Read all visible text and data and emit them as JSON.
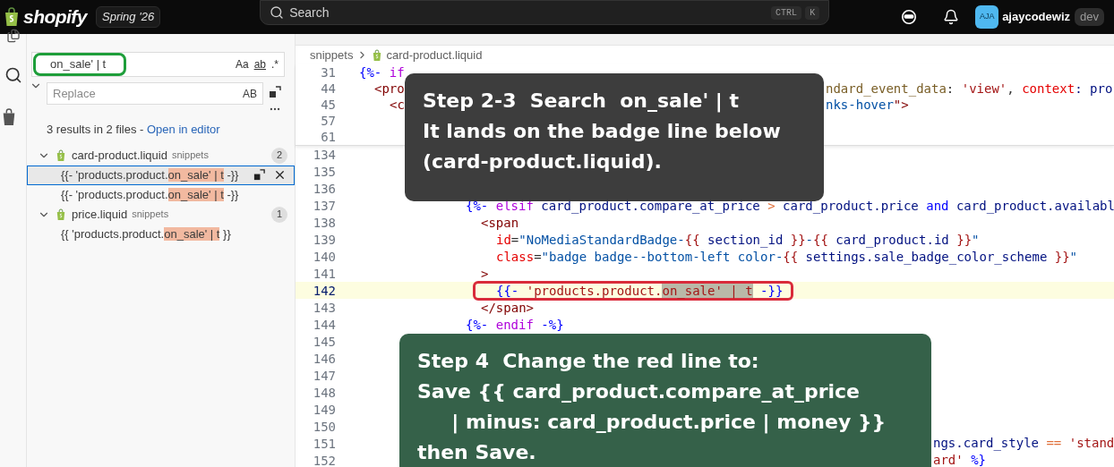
{
  "topbar": {
    "brand": "shopify",
    "release": "Spring '26",
    "search": {
      "placeholder": "Search",
      "keys": [
        "CTRL",
        "K"
      ]
    },
    "avatar": "AJA",
    "user": "ajaycodewiz",
    "env": "dev"
  },
  "sidebar": {
    "search": {
      "value": "on_sale' | t",
      "annotated": true,
      "options": [
        "Aa",
        "ab",
        ".*"
      ]
    },
    "replace": {
      "placeholder": "Replace",
      "option": "AB"
    },
    "summary": "3 results in 2 files - ",
    "summary_link": "Open in editor",
    "files": [
      {
        "name": "card-product.liquid",
        "folder": "snippets",
        "count": "2",
        "expanded": true,
        "results": [
          {
            "before": "{{- 'products.product.",
            "match": "on_sale' | t",
            "after": " -}}",
            "selected": true
          },
          {
            "before": "{{- 'products.product.",
            "match": "on_sale' | t",
            "after": " -}}",
            "selected": false
          }
        ]
      },
      {
        "name": "price.liquid",
        "folder": "snippets",
        "count": "1",
        "expanded": true,
        "results": [
          {
            "before": "{{ 'products.product.",
            "match": "on_sale' | t",
            "after": " }}",
            "selected": false
          }
        ]
      }
    ]
  },
  "editor": {
    "breadcrumb": [
      "snippets",
      "card-product.liquid"
    ],
    "sticky_lines": [
      {
        "number": "31",
        "current": false,
        "code": [
          {
            "text": "{%-",
            "kind": "delim"
          },
          {
            "text": " if",
            "kind": "keyword"
          }
        ]
      },
      {
        "number": "44",
        "current": false,
        "code": [
          {
            "text": "<pro",
            "kind": "tag"
          }
        ],
        "tail": [
          {
            "text": "ndard_event_data",
            "kind": "func"
          },
          {
            "text": ": ",
            "kind": "plain"
          },
          {
            "text": "'view'",
            "kind": "str2"
          },
          {
            "text": ", ",
            "kind": "plain"
          },
          {
            "text": "context",
            "kind": "attr"
          },
          {
            "text": ": pro",
            "kind": "var"
          }
        ]
      },
      {
        "number": "45",
        "current": false,
        "code": [
          {
            "text": "<c",
            "kind": "tag"
          }
        ],
        "tail": [
          {
            "text": "nks-hover",
            "kind": "string"
          },
          {
            "text": "\">",
            "kind": "tag"
          }
        ]
      },
      {
        "number": "57",
        "current": false
      },
      {
        "number": "61",
        "current": false
      }
    ],
    "lines": [
      {
        "number": "134",
        "current": false
      },
      {
        "number": "135",
        "current": false
      },
      {
        "number": "136",
        "current": false
      },
      {
        "number": "137",
        "current": false,
        "code": [
          {
            "text": "{%-",
            "kind": "delim"
          },
          {
            "text": " elsif ",
            "kind": "keyword"
          },
          {
            "text": "card_product.compare_at_price ",
            "kind": "var"
          },
          {
            "text": ">",
            "kind": "op"
          },
          {
            "text": " card_product.price ",
            "kind": "var"
          },
          {
            "text": "and",
            "kind": "delim"
          },
          {
            "text": " card_product.availabl",
            "kind": "var"
          }
        ]
      },
      {
        "number": "138",
        "current": false,
        "code": [
          {
            "text": "<span",
            "kind": "tag"
          }
        ]
      },
      {
        "number": "139",
        "current": false,
        "code": [
          {
            "text": "id",
            "kind": "attr"
          },
          {
            "text": "=",
            "kind": "plain"
          },
          {
            "text": "\"NoMediaStandardBadge-",
            "kind": "string"
          },
          {
            "text": "{{",
            "kind": "str2"
          },
          {
            "text": " section_id ",
            "kind": "var"
          },
          {
            "text": "}}",
            "kind": "str2"
          },
          {
            "text": "-",
            "kind": "string"
          },
          {
            "text": "{{",
            "kind": "str2"
          },
          {
            "text": " card_product.id ",
            "kind": "var"
          },
          {
            "text": "}}",
            "kind": "str2"
          },
          {
            "text": "\"",
            "kind": "string"
          }
        ]
      },
      {
        "number": "140",
        "current": false,
        "code": [
          {
            "text": "class",
            "kind": "attr"
          },
          {
            "text": "=",
            "kind": "plain"
          },
          {
            "text": "\"badge badge--bottom-left color-",
            "kind": "string"
          },
          {
            "text": "{{",
            "kind": "str2"
          },
          {
            "text": " settings.sale_badge_color_scheme ",
            "kind": "var"
          },
          {
            "text": "}}",
            "kind": "str2"
          },
          {
            "text": "\"",
            "kind": "string"
          }
        ]
      },
      {
        "number": "141",
        "current": false,
        "code": [
          {
            "text": ">",
            "kind": "tag"
          }
        ]
      },
      {
        "number": "142",
        "current": true,
        "annotated": true,
        "code": [
          {
            "text": "{{-",
            "kind": "delim"
          },
          {
            "text": " 'products.product.",
            "kind": "str2"
          },
          {
            "text": "on_sale' | t",
            "kind": "match"
          },
          {
            "text": " -}}",
            "kind": "delim"
          }
        ]
      },
      {
        "number": "143",
        "current": false,
        "code": [
          {
            "text": "</span>",
            "kind": "tag"
          }
        ]
      },
      {
        "number": "144",
        "current": false,
        "code": [
          {
            "text": "{%-",
            "kind": "delim"
          },
          {
            "text": " endif ",
            "kind": "keyword"
          },
          {
            "text": "-%}",
            "kind": "delim"
          }
        ]
      },
      {
        "number": "145",
        "current": false
      },
      {
        "number": "146",
        "current": false
      },
      {
        "number": "147",
        "current": false
      },
      {
        "number": "148",
        "current": false
      },
      {
        "number": "149",
        "current": false
      },
      {
        "number": "150",
        "current": false
      },
      {
        "number": "151",
        "current": false,
        "tail": [
          {
            "text": "ngs.card_style ",
            "kind": "var"
          },
          {
            "text": "==",
            "kind": "op"
          },
          {
            "text": " 'stand",
            "kind": "str2"
          }
        ]
      },
      {
        "number": "152",
        "current": false,
        "tail": [
          {
            "text": "ard'",
            "kind": "str2"
          },
          {
            "text": " %}",
            "kind": "delim"
          }
        ]
      }
    ]
  },
  "notes": [
    {
      "kind": "dark",
      "lines": [
        "Step 2-3  Search  on_sale' | t",
        "It lands on the badge line below",
        "(card-product.liquid)."
      ]
    },
    {
      "kind": "green",
      "lines": [
        "Step 4  Change the red line to:",
        "Save {{ card_product.compare_at_price",
        "     | minus: card_product.price | money }}",
        "then Save."
      ]
    }
  ]
}
